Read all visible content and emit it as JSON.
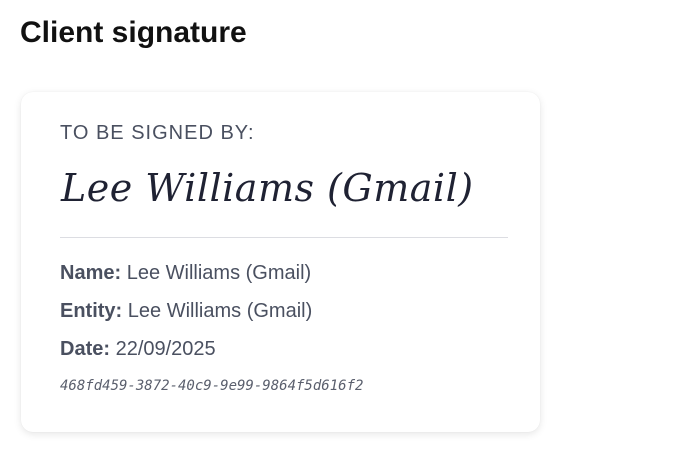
{
  "page": {
    "title": "Client signature"
  },
  "card": {
    "to_be_signed_label": "TO BE SIGNED BY:",
    "signature_text": "Lee Williams (Gmail)",
    "name_label": "Name:",
    "name_value": "Lee Williams (Gmail)",
    "entity_label": "Entity:",
    "entity_value": "Lee Williams (Gmail)",
    "date_label": "Date:",
    "date_value": "22/09/2025",
    "document_id": "468fd459-3872-40c9-9e99-9864f5d616f2"
  }
}
